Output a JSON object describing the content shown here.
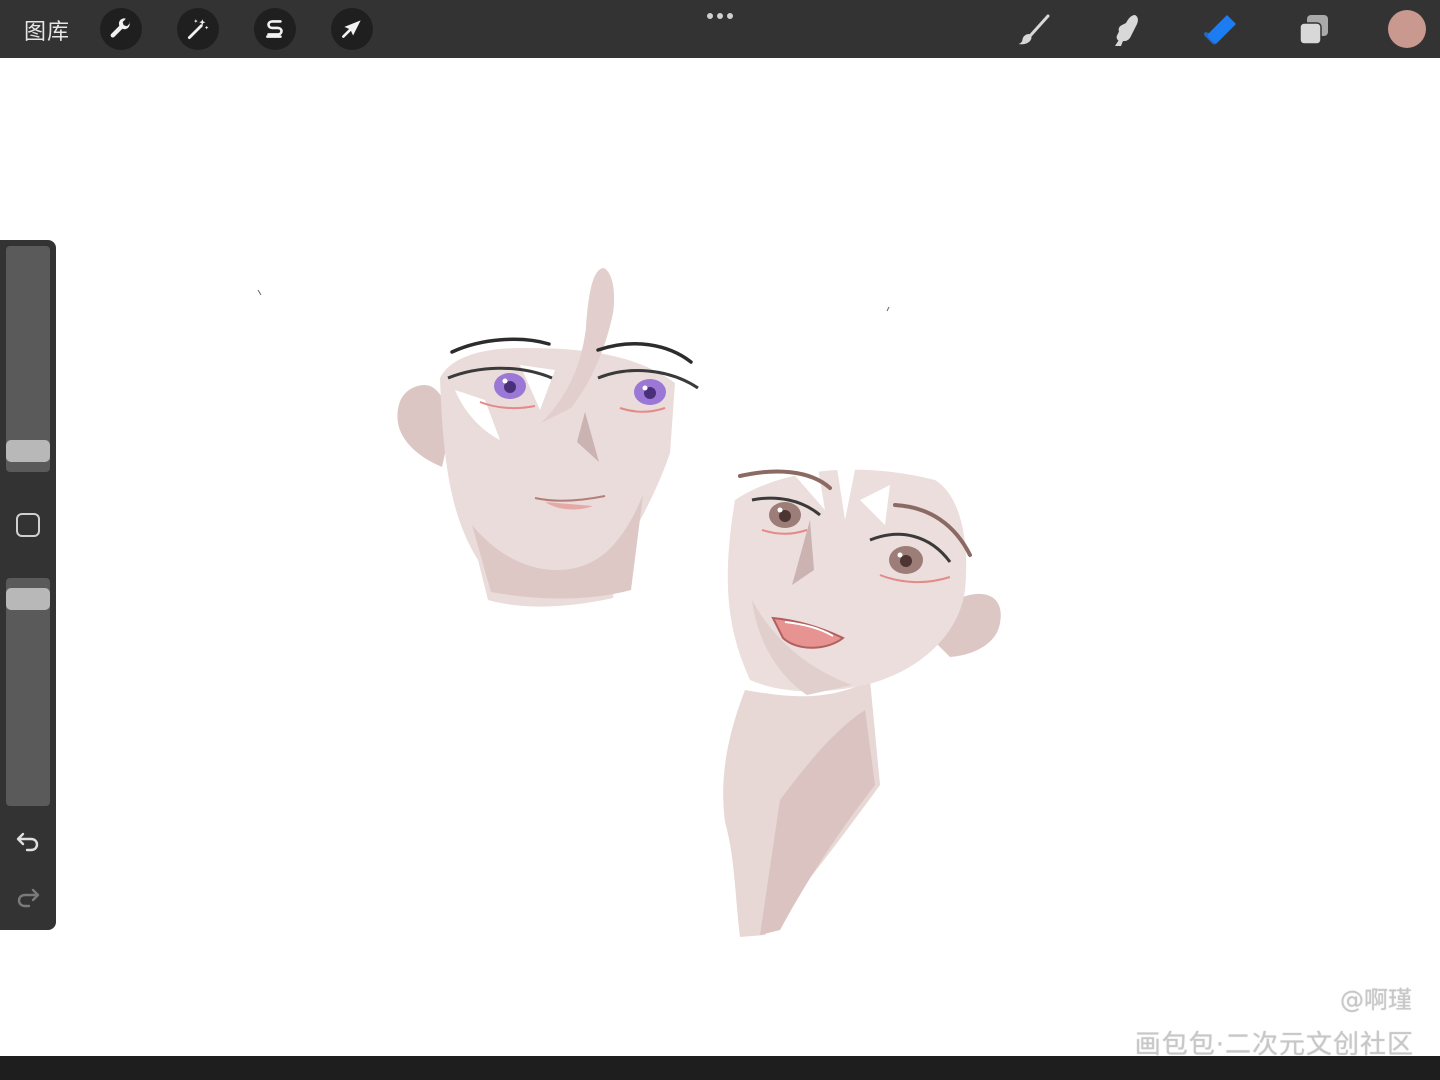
{
  "topbar": {
    "gallery_label": "图库",
    "left_tools": [
      {
        "name": "actions",
        "icon": "wrench-icon"
      },
      {
        "name": "adjustments",
        "icon": "magic-wand-icon"
      },
      {
        "name": "selection",
        "icon": "selection-s-icon"
      },
      {
        "name": "transform",
        "icon": "arrow-cursor-icon"
      }
    ],
    "more_icon": "ellipsis-icon",
    "right_tools": [
      {
        "name": "brush",
        "icon": "brush-icon",
        "active": false
      },
      {
        "name": "smudge",
        "icon": "smudge-finger-icon",
        "active": false
      },
      {
        "name": "eraser",
        "icon": "eraser-icon",
        "active": true
      },
      {
        "name": "layers",
        "icon": "layers-icon",
        "active": false
      }
    ],
    "current_color": "#c9988f",
    "active_color": "#1e7cf2"
  },
  "sidebar": {
    "brush_size_level": 0.05,
    "brush_opacity_level": 0.95,
    "undo_icon": "undo-icon",
    "redo_icon": "redo-icon",
    "modify_icon": "square-modify-icon"
  },
  "watermark": {
    "handle": "@啊瑾",
    "community": "画包包·二次元文创社区"
  }
}
